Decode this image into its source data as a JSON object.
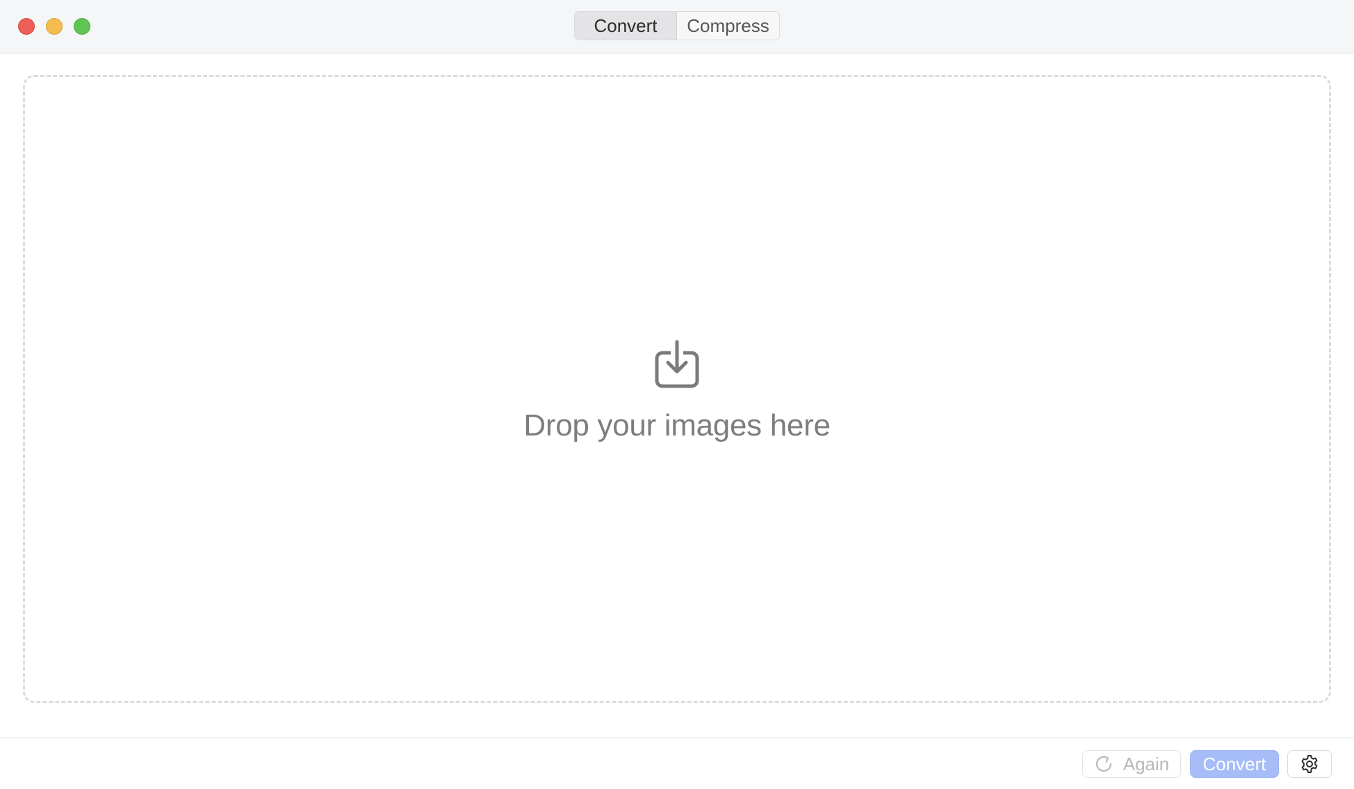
{
  "window": {
    "controls": [
      "close",
      "minimize",
      "maximize"
    ]
  },
  "tabs": [
    {
      "label": "Convert",
      "selected": true
    },
    {
      "label": "Compress",
      "selected": false
    }
  ],
  "dropzone": {
    "icon": "tray-arrow-down-icon",
    "text": "Drop your images here"
  },
  "toolbar": {
    "again_label": "Again",
    "again_icon": "refresh-icon",
    "convert_label": "Convert",
    "settings_icon": "gear-icon"
  },
  "colors": {
    "accent": "#a7bdf8",
    "close": "#ee5f57",
    "minimize": "#f5bd4f",
    "maximize": "#61c454"
  }
}
